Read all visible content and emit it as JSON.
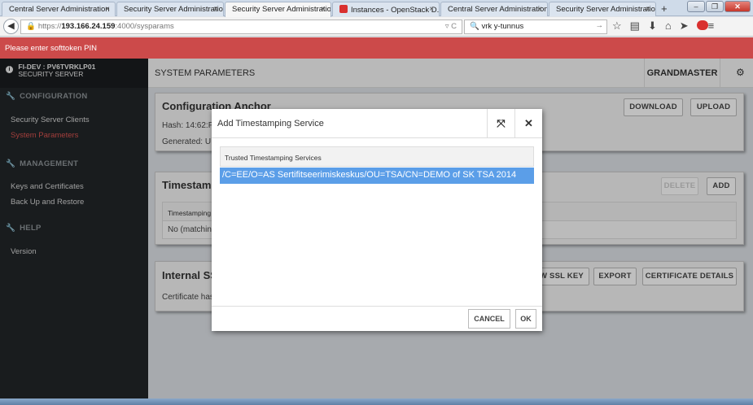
{
  "browser": {
    "tabs": [
      {
        "label": "Central Server Administration",
        "active": false
      },
      {
        "label": "Security Server Administration",
        "active": false
      },
      {
        "label": "Security Server Administration",
        "active": true
      },
      {
        "label": "Instances - OpenStack D...",
        "active": false
      },
      {
        "label": "Central Server Administration",
        "active": false
      },
      {
        "label": "Security Server Administration",
        "active": false
      }
    ],
    "new_tab": "+",
    "url_prefix": "https://",
    "url_host": "193.166.24.159",
    "url_path": ":4000/sysparams",
    "search_value": "vrk y-tunnus"
  },
  "alert": {
    "text": "Please enter softtoken PIN",
    "color": "#cc4a4a"
  },
  "sidebar": {
    "server_line1": "FI-DEV : PV6TVRKLP01",
    "server_line2": "SECURITY SERVER",
    "sections": {
      "configuration": "CONFIGURATION",
      "management": "MANAGEMENT",
      "help": "HELP"
    },
    "items": {
      "clients": "Security Server Clients",
      "sysparams": "System Parameters",
      "keys": "Keys and Certificates",
      "backup": "Back Up and Restore",
      "version": "Version"
    },
    "active_color": "#d9534f"
  },
  "header": {
    "title": "SYSTEM PARAMETERS",
    "user": "GRANDMASTER"
  },
  "anchor": {
    "title": "Configuration Anchor",
    "hash": "Hash: 14:62:F",
    "generated": "Generated: U",
    "download": "DOWNLOAD",
    "upload": "UPLOAD"
  },
  "timestamping": {
    "title": "Timestamp",
    "delete": "DELETE",
    "add": "ADD",
    "col_header": "Timestamping",
    "empty": "No (matching"
  },
  "ssl": {
    "title": "Internal SS",
    "text": "Certificate has",
    "new_key": "W SSL KEY",
    "export": "EXPORT",
    "details": "CERTIFICATE DETAILS"
  },
  "modal": {
    "title": "Add Timestamping Service",
    "list_header": "Trusted Timestamping Services",
    "item": "/C=EE/O=AS Sertifitseerimiskeskus/OU=TSA/CN=DEMO of SK TSA 2014",
    "cancel": "CANCEL",
    "ok": "OK",
    "selected_color": "#5b9ee8"
  }
}
